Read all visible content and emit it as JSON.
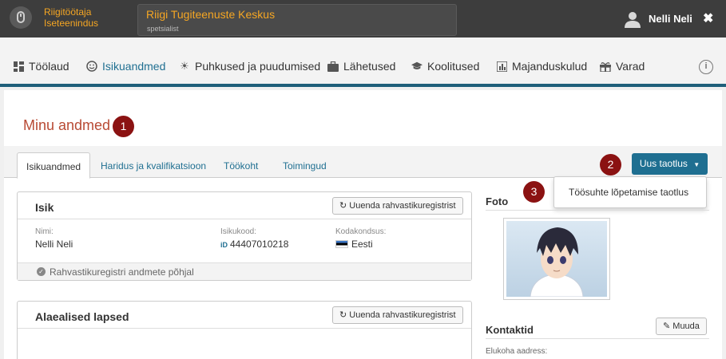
{
  "header": {
    "brand_line1": "Riigitöötaja",
    "brand_line2": "Iseteenindus",
    "org_name": "Riigi Tugiteenuste Keskus",
    "org_role": "spetsialist",
    "user_name": "Nelli Neli"
  },
  "nav": {
    "items": [
      {
        "label": "Töölaud",
        "icon": "dashboard-icon"
      },
      {
        "label": "Isikuandmed",
        "icon": "smiley-icon"
      },
      {
        "label": "Puhkused ja puudumised",
        "icon": "sun-icon"
      },
      {
        "label": "Lähetused",
        "icon": "briefcase-icon"
      },
      {
        "label": "Koolitused",
        "icon": "graduation-cap-icon"
      },
      {
        "label": "Majanduskulud",
        "icon": "bar-chart-icon"
      },
      {
        "label": "Varad",
        "icon": "gift-icon"
      }
    ],
    "active_color": "#1f6f91"
  },
  "page": {
    "title": "Minu andmed",
    "badges": [
      "1",
      "2",
      "3"
    ]
  },
  "tabs": [
    "Isikuandmed",
    "Haridus ja kvalifikatsioon",
    "Töökoht",
    "Toimingud"
  ],
  "actions": {
    "new_request": "Uus taotlus",
    "dropdown_item": "Töösuhte lõpetamise taotlus"
  },
  "isik": {
    "title": "Isik",
    "refresh_button": "Uuenda rahvastikuregistrist",
    "name_label": "Nimi:",
    "name_value": "Nelli Neli",
    "code_label": "Isikukood:",
    "code_value": "44407010218",
    "citizenship_label": "Kodakondsus:",
    "citizenship_value": "Eesti",
    "footer": "Rahvastikuregistri andmete põhjal"
  },
  "children": {
    "title": "Alaealised lapsed",
    "refresh_button": "Uuenda rahvastikuregistrist"
  },
  "photo": {
    "title": "Foto"
  },
  "contacts": {
    "title": "Kontaktid",
    "edit_button": "Muuda",
    "address_label": "Elukoha aadress:"
  },
  "colors": {
    "topbar": "#3d3d3d",
    "brand_accent": "#f5a623",
    "primary": "#1f6f91",
    "title_red": "#b84a34",
    "badge": "#8b1212"
  }
}
